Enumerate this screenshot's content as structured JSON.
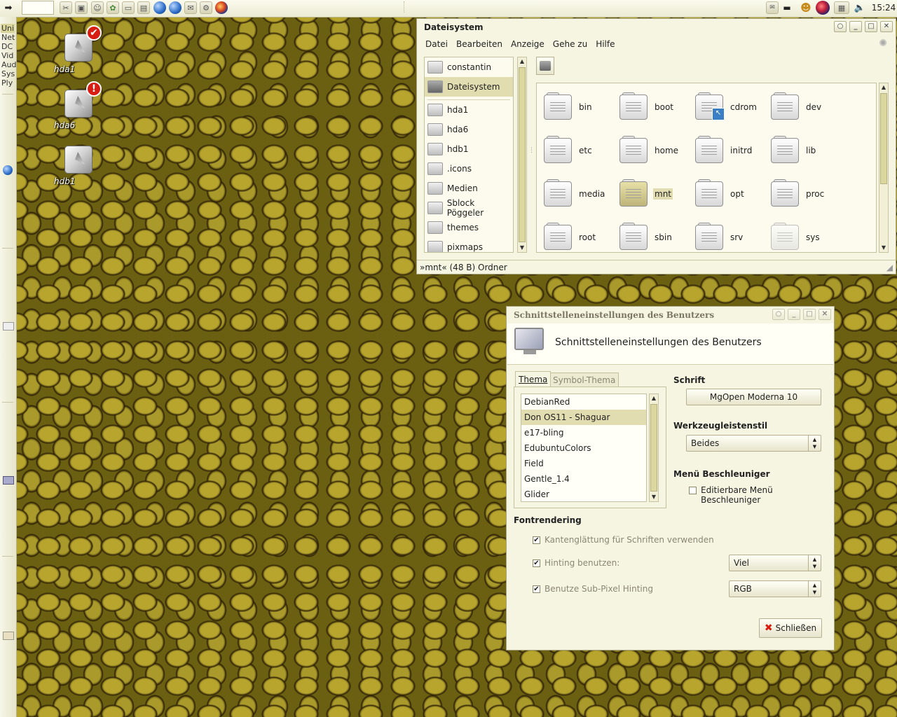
{
  "top_panel": {
    "launchers": [
      "tools-icon",
      "monitor-icon",
      "person-icon",
      "gear-flower-icon",
      "window-icon",
      "image-icon",
      "globe-icon",
      "globe-icon-2",
      "gear-icon",
      "firefox-icon"
    ],
    "tray": [
      "mail-icon",
      "battery-icon",
      "user-icon",
      "network-icon",
      "movie-icon",
      "volume-icon"
    ],
    "clock": "15:24"
  },
  "left_panel": {
    "items": [
      "Uni",
      "Net",
      "DC",
      "Vid",
      "Aud",
      "Sys",
      "Ply"
    ]
  },
  "desktop": {
    "icons": [
      {
        "label": "hda1",
        "badge": "✔"
      },
      {
        "label": "hda6",
        "badge": "!"
      },
      {
        "label": "hdb1",
        "badge": ""
      }
    ]
  },
  "file_manager": {
    "title": "Dateisystem",
    "menus": [
      {
        "label": "Datei",
        "mnemonic": "D"
      },
      {
        "label": "Bearbeiten",
        "mnemonic": "B"
      },
      {
        "label": "Anzeige",
        "mnemonic": "A"
      },
      {
        "label": "Gehe zu",
        "mnemonic": "G"
      },
      {
        "label": "Hilfe",
        "mnemonic": "H"
      }
    ],
    "sidebar": [
      "constantin",
      "Dateisystem",
      "hda1",
      "hda6",
      "hdb1",
      ".icons",
      "Medien",
      "Sblock Pöggeler",
      "themes",
      "pixmaps"
    ],
    "sidebar_selected": "Dateisystem",
    "folders": [
      "bin",
      "boot",
      "cdrom",
      "dev",
      "etc",
      "home",
      "initrd",
      "lib",
      "media",
      "mnt",
      "opt",
      "proc",
      "root",
      "sbin",
      "srv",
      "sys"
    ],
    "selected_folder": "mnt",
    "status": "»mnt« (48 B) Ordner"
  },
  "prefs_dialog": {
    "title": "Schnittstelleneinstellungen des Benutzers",
    "header": "Schnittstelleneinstellungen des Benutzers",
    "tabs": [
      "Thema",
      "Symbol-Thema"
    ],
    "active_tab": "Thema",
    "themes": [
      "DebianRed",
      "Don OS11 - Shaguar",
      "e17-bling",
      "EdubuntuColors",
      "Field",
      "Gentle_1.4",
      "Glider"
    ],
    "selected_theme": "Don OS11 - Shaguar",
    "font_label": "Schrift",
    "font_value": "MgOpen Moderna 10",
    "toolbar_label": "Werkzeugleistenstil",
    "toolbar_value": "Beides",
    "accel_label": "Menü Beschleuniger",
    "accel_checkbox": "Editierbare Menü Beschleuniger",
    "accel_checked": false,
    "fontrender_label": "Fontrendering",
    "antialias": "Kantenglättung für Schriften verwenden",
    "hinting": "Hinting benutzen:",
    "hinting_value": "Viel",
    "subpixel": "Benutze Sub-Pixel Hinting",
    "subpixel_value": "RGB",
    "close_button": "Schließen"
  },
  "colors": {
    "panel": "#f4f3e0",
    "selection": "#e2ddb0",
    "accent_red": "#d81d12"
  }
}
